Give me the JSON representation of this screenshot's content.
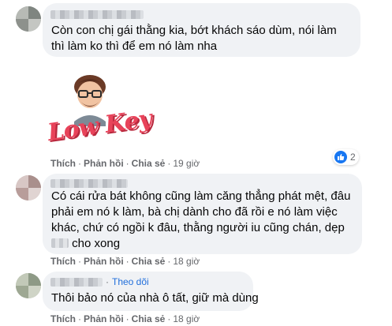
{
  "comments": [
    {
      "text": "Còn con chị gái thằng kia, bớt khách sáo dùm, nói làm thì làm ko thì để em nó làm nha",
      "sticker": {
        "text": "Low Key"
      },
      "actions": {
        "like": "Thích",
        "reply": "Phản hồi",
        "share": "Chia sẻ",
        "time": "19 giờ"
      },
      "reactions": {
        "count": "2",
        "icon": "like-icon"
      }
    },
    {
      "text_before": "Có cái rửa bát không cũng làm căng thẳng phát mệt, đâu phải em nó k làm, bà chị dành cho đã rồi e nó làm việc khác, chứ có ngồi k đâu, thằng người iu cũng chán, dẹp",
      "text_after": "cho xong",
      "actions": {
        "like": "Thích",
        "reply": "Phản hồi",
        "share": "Chia sẻ",
        "time": "18 giờ"
      }
    },
    {
      "follow": "Theo dõi",
      "separator": "·",
      "text": "Thôi bảo nó của nhà ô tất, giữ mà dùng",
      "actions": {
        "like": "Thích",
        "reply": "Phản hồi",
        "share": "Chia sẻ",
        "time": "18 giờ"
      }
    }
  ],
  "colors": {
    "bubble": "#f0f2f5",
    "meta": "#65676b",
    "link": "#216fdb",
    "like": "#1877f2",
    "sticker_text": "#e8435a"
  }
}
